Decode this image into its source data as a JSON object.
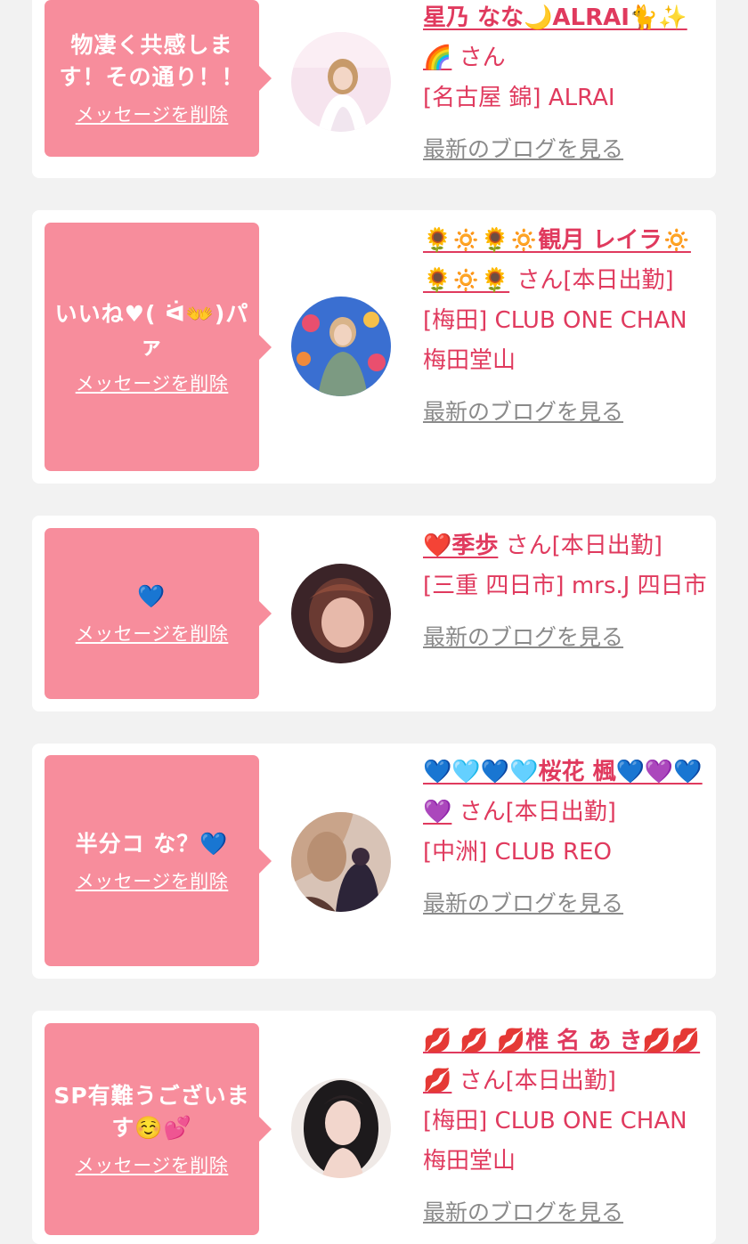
{
  "suffix_san": "さん",
  "delete_label": "メッセージを削除",
  "blog_label": "最新のブログを見る",
  "items": [
    {
      "message": "物凄く共感します！その通り！！",
      "name": "星乃 なな🌙ALRAI🐈✨🌈",
      "status": "",
      "shop": "[名古屋 錦] ALRAI"
    },
    {
      "message": "いいね♥( ᐛ👐)パァ",
      "name": "🌻🔅🌻🔅観月 レイラ🔅🌻🔅🌻",
      "status": "[本日出勤]",
      "shop": "[梅田] CLUB ONE CHAN 梅田堂山"
    },
    {
      "message": "💙",
      "name": "❤️季歩",
      "status": "[本日出勤]",
      "shop": "[三重 四日市] mrs.J 四日市"
    },
    {
      "message": "半分コ な？💙",
      "name": "💙🩵💙🩵桜花 楓💙💜💙💜",
      "status": "[本日出勤]",
      "shop": "[中洲] CLUB REO"
    },
    {
      "message": "SP有難うございます☺️💕",
      "name": "💋 💋 💋椎 名 あ き💋💋 💋",
      "status": "[本日出勤]",
      "shop": "[梅田] CLUB ONE CHAN 梅田堂山"
    }
  ]
}
